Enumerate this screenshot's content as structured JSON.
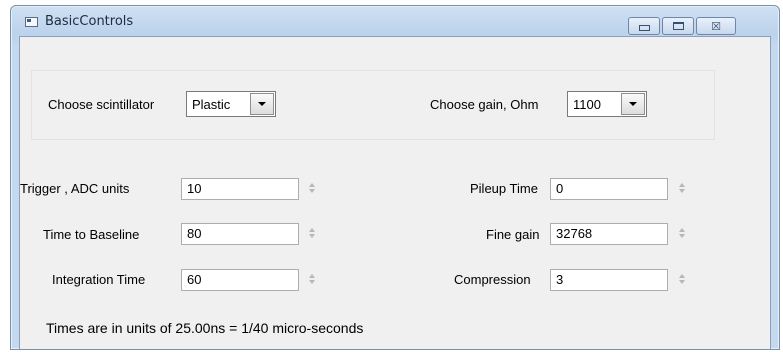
{
  "window": {
    "title": "BasicControls",
    "icon": "app-window-icon",
    "buttons": {
      "minimize": "minimize-icon",
      "maximize": "maximize-icon",
      "close": "close-icon",
      "close_glyph": "☒"
    }
  },
  "scintillator": {
    "label": "Choose scintillator",
    "value": "Plastic"
  },
  "gain": {
    "label": "Choose gain, Ohm",
    "value": "1100"
  },
  "fields": {
    "trigger": {
      "label": "Trigger , ADC units",
      "value": "10"
    },
    "baseline": {
      "label": "Time to Baseline",
      "value": "80"
    },
    "integration": {
      "label": "Integration Time",
      "value": "60"
    },
    "pileup": {
      "label": "Pileup Time",
      "value": "0"
    },
    "fine_gain": {
      "label": "Fine gain",
      "value": "32768"
    },
    "compression": {
      "label": "Compression",
      "value": "3"
    }
  },
  "note": "Times are in units of 25.00ns = 1/40 micro-seconds"
}
